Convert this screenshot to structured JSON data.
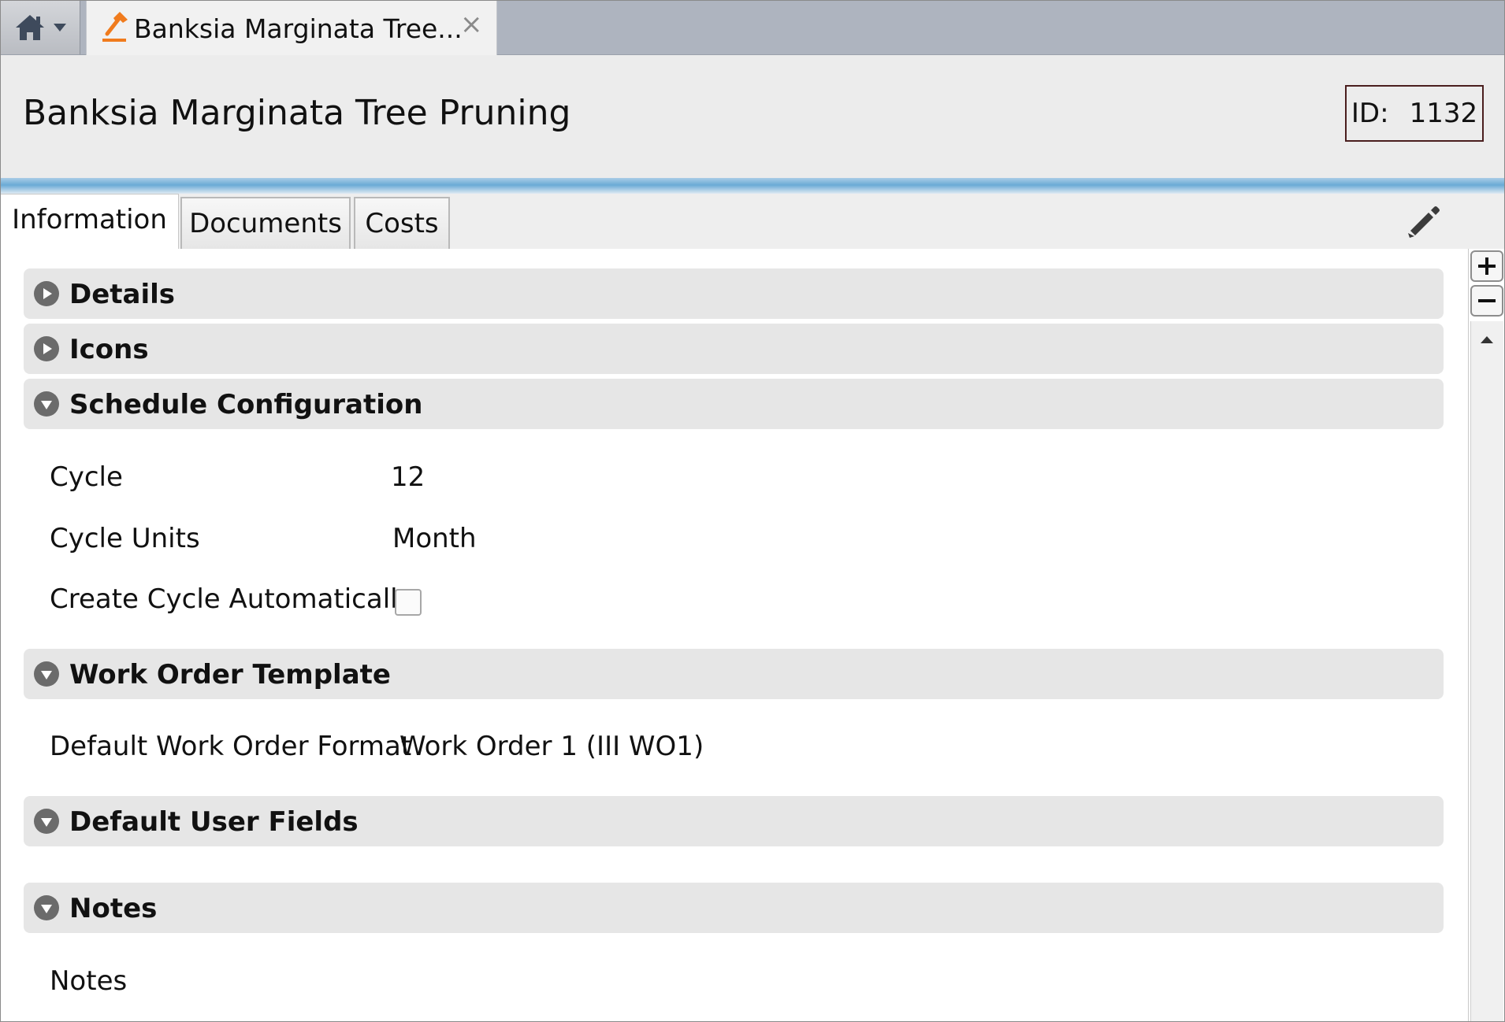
{
  "window": {
    "tab_title": "Banksia Marginata Tree...",
    "tab_close": "×",
    "tab_icon": "hammer-icon",
    "home_icon": "house-icon"
  },
  "header": {
    "title": "Banksia Marginata Tree Pruning",
    "id_label": "ID:",
    "id_value": "1132"
  },
  "tabs": [
    {
      "label": "Information",
      "active": true
    },
    {
      "label": "Documents",
      "active": false
    },
    {
      "label": "Costs",
      "active": false
    }
  ],
  "sections": {
    "details": {
      "title": "Details",
      "expanded": false
    },
    "icons": {
      "title": "Icons",
      "expanded": false
    },
    "schedule": {
      "title": "Schedule Configuration",
      "expanded": true,
      "fields": {
        "cycle": {
          "label": "Cycle",
          "value": "12"
        },
        "cycle_units": {
          "label": "Cycle Units",
          "value": "Month"
        },
        "create_cycle": {
          "label": "Create Cycle Automatically",
          "checked": false
        }
      }
    },
    "work_order": {
      "title": "Work Order Template",
      "expanded": true,
      "fields": {
        "default_format": {
          "label": "Default Work Order Format",
          "value": "Work Order 1 (III WO1)"
        }
      }
    },
    "user_fields": {
      "title": "Default User Fields",
      "expanded": true
    },
    "notes": {
      "title": "Notes",
      "expanded": true,
      "fields": {
        "notes": {
          "label": "Notes"
        }
      }
    }
  },
  "colors": {
    "accent_blue": "#6aaad6",
    "tab_icon_orange": "#f07b1d",
    "section_bg": "#e6e6e6",
    "id_border": "#4a1e1e"
  }
}
